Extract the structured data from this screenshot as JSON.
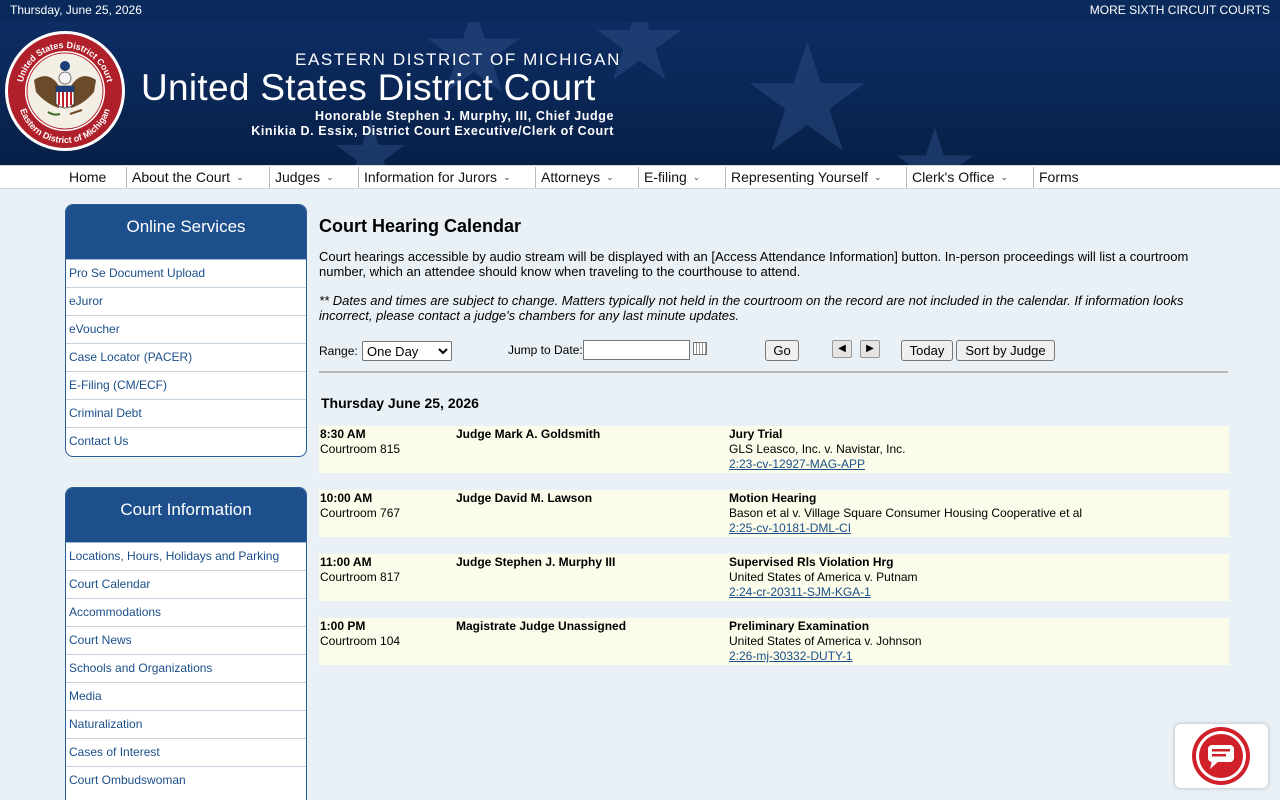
{
  "topbar": {
    "date": "Thursday, June 25, 2026",
    "more_courts": "MORE SIXTH CIRCUIT COURTS"
  },
  "header": {
    "subtitle": "EASTERN DISTRICT OF MICHIGAN",
    "title": "United States District Court",
    "chief_judge": "Honorable Stephen J. Murphy, III, Chief Judge",
    "clerk": "Kinikia D. Essix, District Court Executive/Clerk of Court",
    "seal_text_top": "United States District Court",
    "seal_text_bottom": "Eastern District of Michigan"
  },
  "nav": {
    "items": [
      {
        "label": "Home"
      },
      {
        "label": "About the Court"
      },
      {
        "label": "Judges"
      },
      {
        "label": "Information for Jurors"
      },
      {
        "label": "Attorneys"
      },
      {
        "label": "E-filing"
      },
      {
        "label": "Representing Yourself"
      },
      {
        "label": "Clerk's Office"
      },
      {
        "label": "Forms"
      }
    ],
    "chevron": "⌄"
  },
  "online_services": {
    "title": "Online Services",
    "items": [
      "Pro Se Document Upload",
      "eJuror",
      "eVoucher",
      "Case Locator (PACER)",
      "E-Filing (CM/ECF)",
      "Criminal Debt",
      "Contact Us"
    ]
  },
  "court_information": {
    "title": "Court Information",
    "items": [
      "Locations, Hours, Holidays and Parking",
      "Court Calendar",
      "Accommodations",
      "Court News",
      "Schools and Organizations",
      "Media",
      "Naturalization",
      "Cases of Interest",
      "Court Ombudswoman"
    ]
  },
  "main": {
    "title": "Court Hearing Calendar",
    "intro": "Court hearings accessible by audio stream will be displayed with an [Access Attendance Information] button. In-person proceedings will list a courtroom number, which an attendee should know when traveling to the courthouse to attend.",
    "note": "** Dates and times are subject to change. Matters typically not held in the courtroom on the record are not included in the calendar. If information looks incorrect, please contact a judge's chambers for any last minute updates."
  },
  "controls": {
    "range_label": "Range:",
    "range_selected": "One Day",
    "jump_label": "Jump to Date:",
    "jump_value": "",
    "go_label": "Go",
    "prev_icon": "◀",
    "next_icon": "▶",
    "today_label": "Today",
    "sort_label": "Sort by Judge"
  },
  "calendar": {
    "day_heading": "Thursday June 25, 2026",
    "hearings": [
      {
        "time": "8:30 AM",
        "room": "Courtroom 815",
        "judge": "Judge Mark A. Goldsmith",
        "type": "Jury Trial",
        "parties": "GLS Leasco, Inc. v. Navistar, Inc.",
        "case": "2:23-cv-12927-MAG-APP"
      },
      {
        "time": "10:00 AM",
        "room": "Courtroom 767",
        "judge": "Judge David M. Lawson",
        "type": "Motion Hearing",
        "parties": "Bason et al v. Village Square Consumer Housing Cooperative et al",
        "case": "2:25-cv-10181-DML-CI"
      },
      {
        "time": "11:00 AM",
        "room": "Courtroom 817",
        "judge": "Judge Stephen J. Murphy III",
        "type": "Supervised Rls Violation Hrg",
        "parties": "United States of America v. Putnam",
        "case": "2:24-cr-20311-SJM-KGA-1"
      },
      {
        "time": "1:00 PM",
        "room": "Courtroom 104",
        "judge": "Magistrate Judge Unassigned",
        "type": "Preliminary Examination",
        "parties": "United States of America v. Johnson",
        "case": "2:26-mj-30332-DUTY-1"
      }
    ]
  },
  "colors": {
    "header_bg": "#0b2a5c",
    "sidebar_head": "#1d4f8c",
    "link": "#1b4f8a",
    "hearing_bg": "#fcfcea",
    "chat_red": "#d0202a"
  },
  "icons": {
    "seal": "court-seal",
    "calendar": "calendar-icon",
    "chat": "chat-bubble-icon"
  }
}
